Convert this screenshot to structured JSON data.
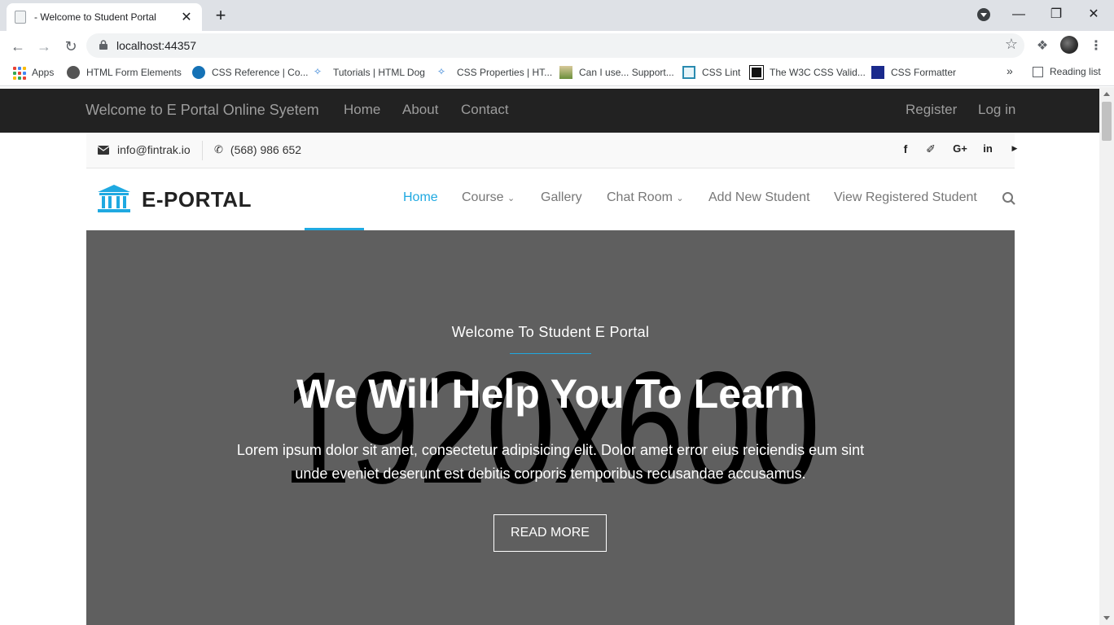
{
  "browser": {
    "tab_title": "- Welcome to Student Portal",
    "tab_close": "✕",
    "new_tab": "+",
    "url": "localhost:44357",
    "bookmarks": [
      {
        "label": "Apps"
      },
      {
        "label": "HTML Form Elements"
      },
      {
        "label": "CSS Reference | Co..."
      },
      {
        "label": "Tutorials | HTML Dog"
      },
      {
        "label": "CSS Properties | HT..."
      },
      {
        "label": "Can I use... Support..."
      },
      {
        "label": "CSS Lint"
      },
      {
        "label": "The W3C CSS Valid..."
      },
      {
        "label": "CSS Formatter"
      }
    ],
    "more_bookmarks": "»",
    "reading_list": "Reading list"
  },
  "topnav": {
    "brand": "Welcome to E Portal Online Syetem",
    "links": [
      "Home",
      "About",
      "Contact"
    ],
    "register": "Register",
    "login": "Log in"
  },
  "contact": {
    "email": "info@fintrak.io",
    "phone": "(568) 986 652",
    "social": [
      "facebook-icon",
      "twitter-icon",
      "google-plus-icon",
      "linkedin-icon",
      "youtube-icon"
    ]
  },
  "mainnav": {
    "logo_text": "E-PORTAL",
    "items": [
      "Home",
      "Course",
      "Gallery",
      "Chat Room",
      "Add New Student",
      "View Registered Student"
    ],
    "accent": "#1fa9e1"
  },
  "hero": {
    "placeholder": "1920x600",
    "subtitle": "Welcome To Student E Portal",
    "headline": "We Will Help You To Learn",
    "lead": "Lorem ipsum dolor sit amet, consectetur adipisicing elit. Dolor amet error eius reiciendis eum sint unde eveniet deserunt est debitis corporis temporibus recusandae accusamus.",
    "button": "READ MORE"
  }
}
